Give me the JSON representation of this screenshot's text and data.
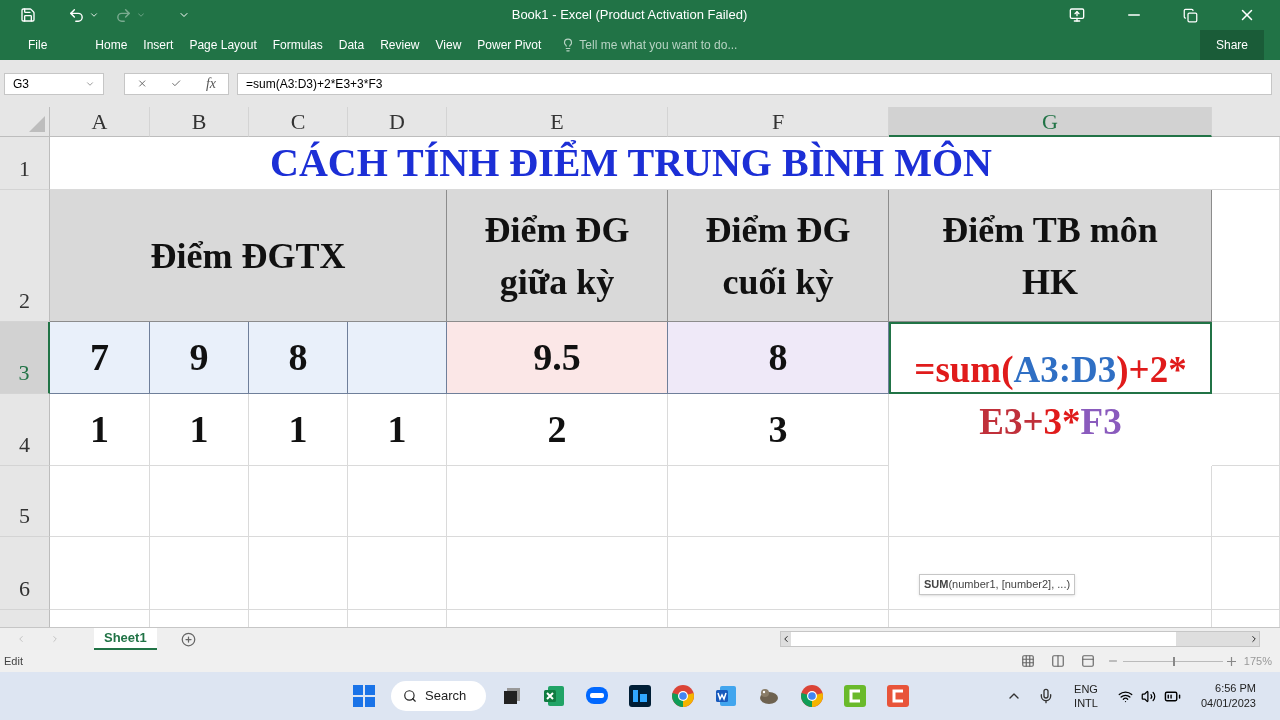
{
  "window": {
    "title": "Book1 - Excel (Product Activation Failed)"
  },
  "ribbon": {
    "tabs": [
      {
        "label": "File",
        "selected": false
      },
      {
        "label": "Home",
        "selected": false
      },
      {
        "label": "Insert",
        "selected": false
      },
      {
        "label": "Page Layout",
        "selected": false
      },
      {
        "label": "Formulas",
        "selected": false
      },
      {
        "label": "Data",
        "selected": false
      },
      {
        "label": "Review",
        "selected": false
      },
      {
        "label": "View",
        "selected": false
      },
      {
        "label": "Power Pivot",
        "selected": false
      }
    ],
    "tell_me": {
      "placeholder": "Tell me what you want to do..."
    },
    "share": "Share"
  },
  "formula_bar": {
    "name_box": "G3",
    "fx": "fx",
    "formula": "=sum(A3:D3)+2*E3+3*F3"
  },
  "columns": [
    {
      "label": "A",
      "selected": false
    },
    {
      "label": "B",
      "selected": false
    },
    {
      "label": "C",
      "selected": false
    },
    {
      "label": "D",
      "selected": false
    },
    {
      "label": "E",
      "selected": false
    },
    {
      "label": "F",
      "selected": false
    },
    {
      "label": "G",
      "selected": true
    }
  ],
  "rows": [
    {
      "label": "1",
      "selected": false
    },
    {
      "label": "2",
      "selected": false
    },
    {
      "label": "3",
      "selected": true
    },
    {
      "label": "4",
      "selected": false
    },
    {
      "label": "5",
      "selected": false
    },
    {
      "label": "6",
      "selected": false
    }
  ],
  "sheet": {
    "title": "CÁCH TÍNH ĐIỂM TRUNG BÌNH MÔN",
    "headers": [
      "Điểm ĐGTX",
      "Điểm ĐG\ngiữa kỳ",
      "Điểm ĐG\ncuối kỳ",
      "Điểm TB môn\nHK"
    ],
    "row3": [
      {
        "text": "7",
        "color": "#e9f0fa"
      },
      {
        "text": "9",
        "color": "#e9f0fa"
      },
      {
        "text": "8",
        "color": "#e9f0fa"
      },
      {
        "color": "#e9f0fa"
      },
      {
        "text": "9.5",
        "color": "#fbe7e7"
      },
      {
        "text": "8",
        "color": "#efe9f8"
      }
    ],
    "row4": [
      "1",
      "1",
      "1",
      "1",
      "2",
      "3"
    ],
    "active_cell": [
      [
        {
          "text": "=sum(",
          "color": "#e01b1b"
        },
        {
          "text": "A3:D3",
          "color": "#2f6fc4"
        },
        {
          "text": ")+2*",
          "color": "#e01b1b"
        }
      ],
      [
        {
          "text": "E3+",
          "color": "#c0303a"
        },
        {
          "text": "3*",
          "color": "#e01b1b"
        },
        {
          "text": "F3",
          "color": "#8a5bbd"
        }
      ]
    ],
    "tooltip": "**SUM**(number1, [number2], ...)"
  },
  "sheet_tabs": [
    {
      "label": "Sheet1",
      "selected": true
    }
  ],
  "status_bar": {
    "mode": "Edit",
    "zoom": "175%",
    "zoom_slider": {
      "level": 0.5
    }
  },
  "taskbar": {
    "search": "Search",
    "language": [
      "ENG",
      "INTL"
    ],
    "time": "6:56 PM",
    "date": "04/01/2023"
  }
}
